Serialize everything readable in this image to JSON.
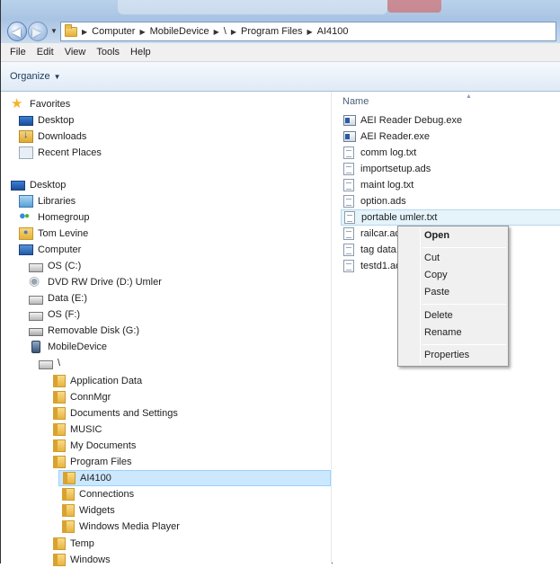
{
  "breadcrumb": [
    "Computer",
    "MobileDevice",
    "\\",
    "Program Files",
    "AI4100"
  ],
  "menu": [
    "File",
    "Edit",
    "View",
    "Tools",
    "Help"
  ],
  "command": {
    "organize_label": "Organize"
  },
  "nav": {
    "favorites": {
      "label": "Favorites",
      "items": [
        "Desktop",
        "Downloads",
        "Recent Places"
      ]
    },
    "desktop_label": "Desktop",
    "libraries": "Libraries",
    "homegroup": "Homegroup",
    "user": "Tom Levine",
    "computer": "Computer",
    "drives": [
      "OS (C:)",
      "DVD RW Drive (D:) Umler",
      "Data (E:)",
      "OS (F:)",
      "Removable Disk (G:)"
    ],
    "mobile": "MobileDevice",
    "root": "\\",
    "root_folders": [
      "Application Data",
      "ConnMgr",
      "Documents and Settings",
      "MUSIC",
      "My Documents",
      "Program Files"
    ],
    "program_files_children": [
      "AI4100",
      "Connections",
      "Widgets",
      "Windows Media Player"
    ],
    "after": [
      "Temp",
      "Windows"
    ]
  },
  "files": {
    "column_name": "Name",
    "items": [
      "AEI Reader Debug.exe",
      "AEI Reader.exe",
      "comm log.txt",
      "importsetup.ads",
      "maint log.txt",
      "option.ads",
      "portable umler.txt",
      "railcar.ad",
      "tag data.t",
      "testd1.ad"
    ],
    "selected_index": 6
  },
  "context_menu": {
    "open": "Open",
    "cut": "Cut",
    "copy": "Copy",
    "paste": "Paste",
    "delete": "Delete",
    "rename": "Rename",
    "properties": "Properties"
  }
}
